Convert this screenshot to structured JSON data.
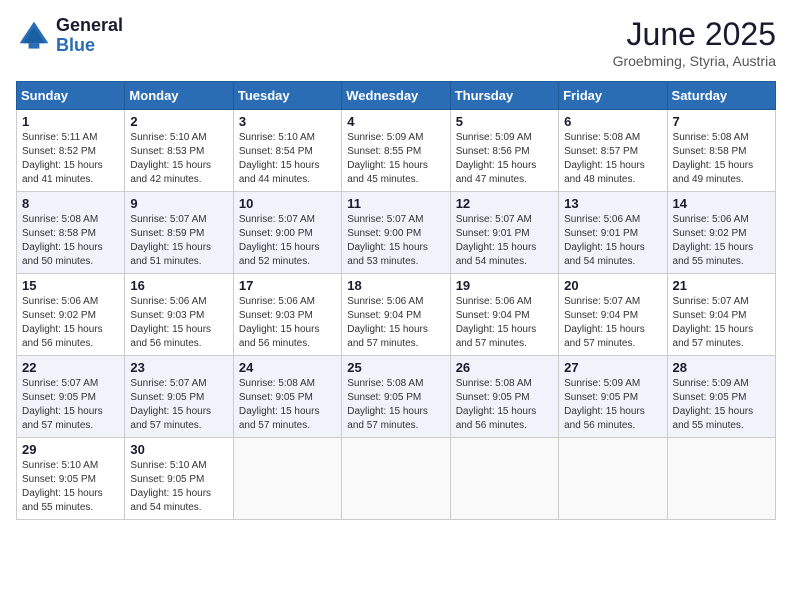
{
  "logo": {
    "line1": "General",
    "line2": "Blue"
  },
  "title": "June 2025",
  "location": "Groebming, Styria, Austria",
  "headers": [
    "Sunday",
    "Monday",
    "Tuesday",
    "Wednesday",
    "Thursday",
    "Friday",
    "Saturday"
  ],
  "weeks": [
    [
      {
        "day": "1",
        "info": "Sunrise: 5:11 AM\nSunset: 8:52 PM\nDaylight: 15 hours\nand 41 minutes."
      },
      {
        "day": "2",
        "info": "Sunrise: 5:10 AM\nSunset: 8:53 PM\nDaylight: 15 hours\nand 42 minutes."
      },
      {
        "day": "3",
        "info": "Sunrise: 5:10 AM\nSunset: 8:54 PM\nDaylight: 15 hours\nand 44 minutes."
      },
      {
        "day": "4",
        "info": "Sunrise: 5:09 AM\nSunset: 8:55 PM\nDaylight: 15 hours\nand 45 minutes."
      },
      {
        "day": "5",
        "info": "Sunrise: 5:09 AM\nSunset: 8:56 PM\nDaylight: 15 hours\nand 47 minutes."
      },
      {
        "day": "6",
        "info": "Sunrise: 5:08 AM\nSunset: 8:57 PM\nDaylight: 15 hours\nand 48 minutes."
      },
      {
        "day": "7",
        "info": "Sunrise: 5:08 AM\nSunset: 8:58 PM\nDaylight: 15 hours\nand 49 minutes."
      }
    ],
    [
      {
        "day": "8",
        "info": "Sunrise: 5:08 AM\nSunset: 8:58 PM\nDaylight: 15 hours\nand 50 minutes."
      },
      {
        "day": "9",
        "info": "Sunrise: 5:07 AM\nSunset: 8:59 PM\nDaylight: 15 hours\nand 51 minutes."
      },
      {
        "day": "10",
        "info": "Sunrise: 5:07 AM\nSunset: 9:00 PM\nDaylight: 15 hours\nand 52 minutes."
      },
      {
        "day": "11",
        "info": "Sunrise: 5:07 AM\nSunset: 9:00 PM\nDaylight: 15 hours\nand 53 minutes."
      },
      {
        "day": "12",
        "info": "Sunrise: 5:07 AM\nSunset: 9:01 PM\nDaylight: 15 hours\nand 54 minutes."
      },
      {
        "day": "13",
        "info": "Sunrise: 5:06 AM\nSunset: 9:01 PM\nDaylight: 15 hours\nand 54 minutes."
      },
      {
        "day": "14",
        "info": "Sunrise: 5:06 AM\nSunset: 9:02 PM\nDaylight: 15 hours\nand 55 minutes."
      }
    ],
    [
      {
        "day": "15",
        "info": "Sunrise: 5:06 AM\nSunset: 9:02 PM\nDaylight: 15 hours\nand 56 minutes."
      },
      {
        "day": "16",
        "info": "Sunrise: 5:06 AM\nSunset: 9:03 PM\nDaylight: 15 hours\nand 56 minutes."
      },
      {
        "day": "17",
        "info": "Sunrise: 5:06 AM\nSunset: 9:03 PM\nDaylight: 15 hours\nand 56 minutes."
      },
      {
        "day": "18",
        "info": "Sunrise: 5:06 AM\nSunset: 9:04 PM\nDaylight: 15 hours\nand 57 minutes."
      },
      {
        "day": "19",
        "info": "Sunrise: 5:06 AM\nSunset: 9:04 PM\nDaylight: 15 hours\nand 57 minutes."
      },
      {
        "day": "20",
        "info": "Sunrise: 5:07 AM\nSunset: 9:04 PM\nDaylight: 15 hours\nand 57 minutes."
      },
      {
        "day": "21",
        "info": "Sunrise: 5:07 AM\nSunset: 9:04 PM\nDaylight: 15 hours\nand 57 minutes."
      }
    ],
    [
      {
        "day": "22",
        "info": "Sunrise: 5:07 AM\nSunset: 9:05 PM\nDaylight: 15 hours\nand 57 minutes."
      },
      {
        "day": "23",
        "info": "Sunrise: 5:07 AM\nSunset: 9:05 PM\nDaylight: 15 hours\nand 57 minutes."
      },
      {
        "day": "24",
        "info": "Sunrise: 5:08 AM\nSunset: 9:05 PM\nDaylight: 15 hours\nand 57 minutes."
      },
      {
        "day": "25",
        "info": "Sunrise: 5:08 AM\nSunset: 9:05 PM\nDaylight: 15 hours\nand 57 minutes."
      },
      {
        "day": "26",
        "info": "Sunrise: 5:08 AM\nSunset: 9:05 PM\nDaylight: 15 hours\nand 56 minutes."
      },
      {
        "day": "27",
        "info": "Sunrise: 5:09 AM\nSunset: 9:05 PM\nDaylight: 15 hours\nand 56 minutes."
      },
      {
        "day": "28",
        "info": "Sunrise: 5:09 AM\nSunset: 9:05 PM\nDaylight: 15 hours\nand 55 minutes."
      }
    ],
    [
      {
        "day": "29",
        "info": "Sunrise: 5:10 AM\nSunset: 9:05 PM\nDaylight: 15 hours\nand 55 minutes."
      },
      {
        "day": "30",
        "info": "Sunrise: 5:10 AM\nSunset: 9:05 PM\nDaylight: 15 hours\nand 54 minutes."
      },
      {
        "day": "",
        "info": ""
      },
      {
        "day": "",
        "info": ""
      },
      {
        "day": "",
        "info": ""
      },
      {
        "day": "",
        "info": ""
      },
      {
        "day": "",
        "info": ""
      }
    ]
  ]
}
